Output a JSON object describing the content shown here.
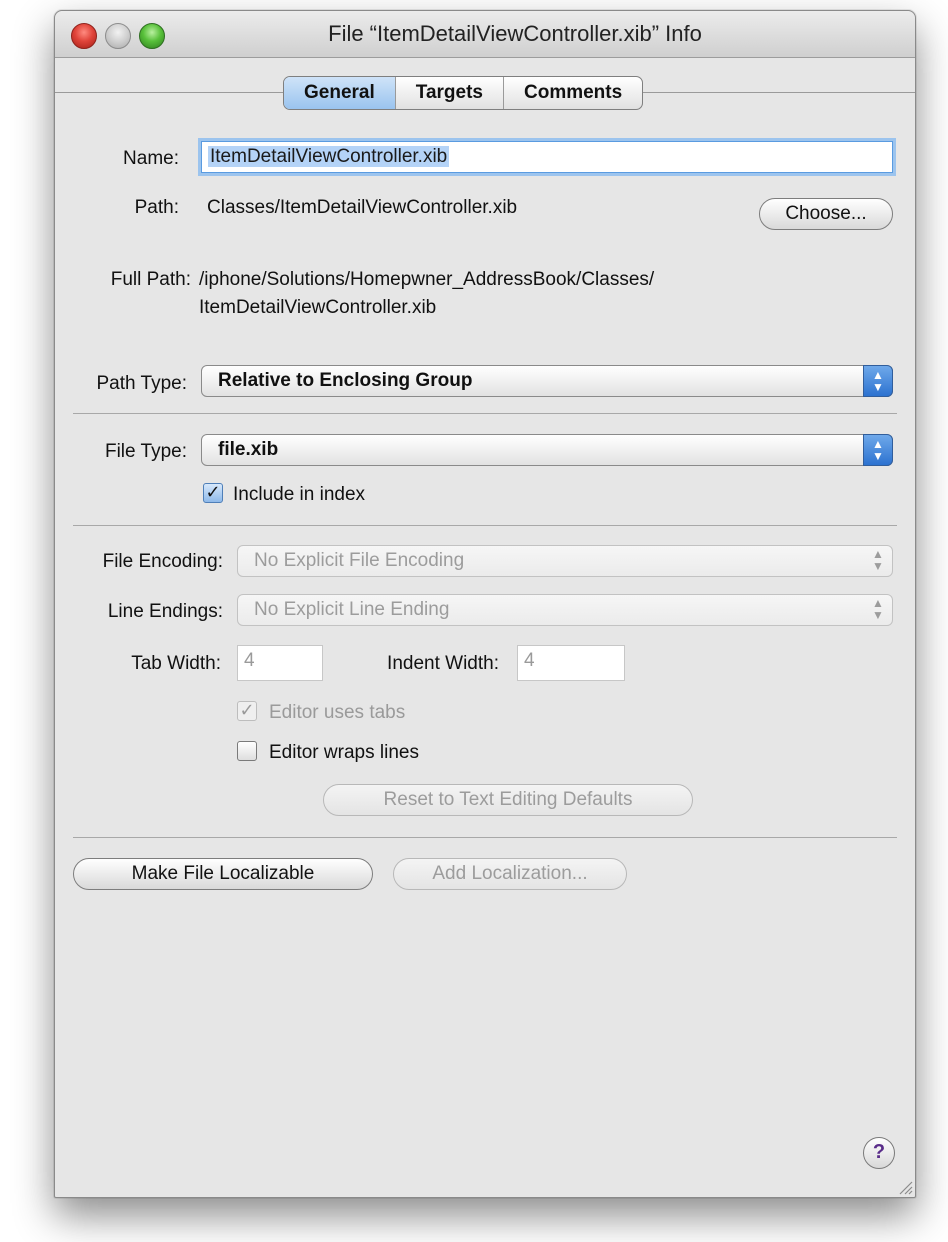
{
  "window": {
    "title": "File “ItemDetailViewController.xib” Info"
  },
  "tabs": [
    {
      "label": "General",
      "active": true
    },
    {
      "label": "Targets",
      "active": false
    },
    {
      "label": "Comments",
      "active": false
    }
  ],
  "general": {
    "name_label": "Name:",
    "name_value": "ItemDetailViewController.xib",
    "path_label": "Path:",
    "path_value": "Classes/ItemDetailViewController.xib",
    "choose_button": "Choose...",
    "full_path_label": "Full Path:",
    "full_path_line1": "/iphone/Solutions/Homepwner_AddressBook/Classes/",
    "full_path_line2": "ItemDetailViewController.xib",
    "path_type_label": "Path Type:",
    "path_type_value": "Relative to Enclosing Group",
    "file_type_label": "File Type:",
    "file_type_value": "file.xib",
    "include_in_index_label": "Include in index",
    "include_in_index_checked": true,
    "file_encoding_label": "File Encoding:",
    "file_encoding_value": "No Explicit File Encoding",
    "line_endings_label": "Line Endings:",
    "line_endings_value": "No Explicit Line Ending",
    "tab_width_label": "Tab Width:",
    "tab_width_value": "4",
    "indent_width_label": "Indent Width:",
    "indent_width_value": "4",
    "editor_uses_tabs_label": "Editor uses tabs",
    "editor_uses_tabs_checked": true,
    "editor_wraps_lines_label": "Editor wraps lines",
    "editor_wraps_lines_checked": false,
    "reset_button": "Reset to Text Editing Defaults",
    "make_localizable_button": "Make File Localizable",
    "add_localization_button": "Add Localization..."
  },
  "help_glyph": "?",
  "checkmark_glyph": "✓",
  "popup_arrows_glyph": "▲▼",
  "icons": [
    "close-icon",
    "minimize-icon",
    "zoom-icon",
    "help-icon",
    "resize-grip-icon"
  ]
}
